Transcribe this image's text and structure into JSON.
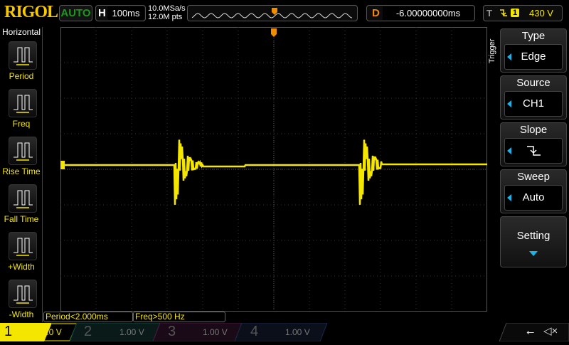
{
  "header": {
    "logo": "RIGOL",
    "run_status": "AUTO",
    "timebase_label": "H",
    "timebase": "100ms",
    "sample_rate": "10.0MSa/s",
    "memory_depth": "12.0M pts",
    "delay_label": "D",
    "delay": "-6.00000000ms",
    "trigger_label": "T",
    "trigger_slope_icon": "falling-edge-icon",
    "trigger_source": "1",
    "trigger_level": "430 V"
  },
  "left_menu": {
    "title": "Horizontal",
    "items": [
      {
        "label": "Period"
      },
      {
        "label": "Freq"
      },
      {
        "label": "Rise Time"
      },
      {
        "label": "Fall Time"
      },
      {
        "label": "+Width"
      },
      {
        "label": "-Width"
      }
    ]
  },
  "right_menu": {
    "tab": "Trigger",
    "items": [
      {
        "title": "Type",
        "value": "Edge"
      },
      {
        "title": "Source",
        "value": "CH1"
      },
      {
        "title": "Slope",
        "value": ""
      },
      {
        "title": "Sweep",
        "value": "Auto"
      },
      {
        "title": "Setting",
        "value": ""
      }
    ]
  },
  "measurements": [
    "Period<2.000ms",
    "Freq>500 Hz"
  ],
  "channels": [
    {
      "num": "1",
      "scale": "20.0 V",
      "color": "#f5e600",
      "active": true
    },
    {
      "num": "2",
      "scale": "1.00 V",
      "color": "#0e8a7a"
    },
    {
      "num": "3",
      "scale": "1.00 V",
      "color": "#b0209a"
    },
    {
      "num": "4",
      "scale": "1.00 V",
      "color": "#1a5ab0"
    }
  ],
  "colors": {
    "ch1": "#f5e600",
    "accent": "#1ab4e8",
    "delay": "#f08c00"
  }
}
